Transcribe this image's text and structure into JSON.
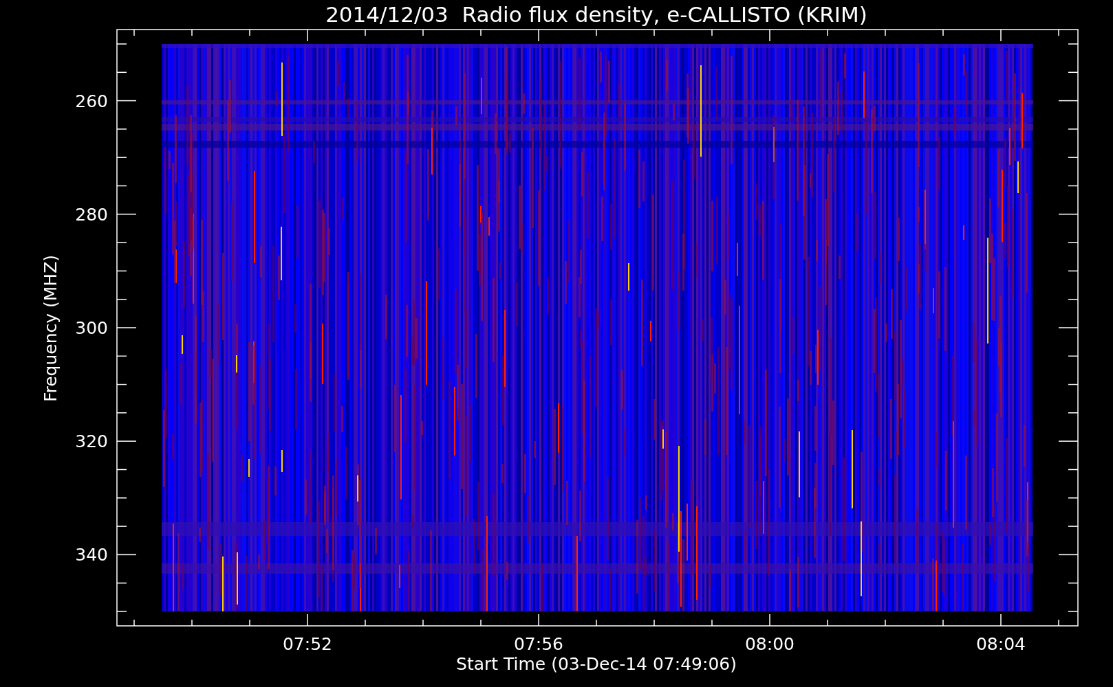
{
  "title": "2014/12/03  Radio flux density, e-CALLISTO (KRIM)",
  "plot": {
    "y_axis": {
      "label": "Frequency (MHZ)",
      "tick_labels": [
        "260",
        "280",
        "300",
        "320",
        "340"
      ]
    },
    "x_axis": {
      "label": "Start Time (03-Dec-14 07:49:06)",
      "tick_labels": [
        "07:52",
        "07:56",
        "08:00",
        "08:04"
      ]
    }
  }
}
